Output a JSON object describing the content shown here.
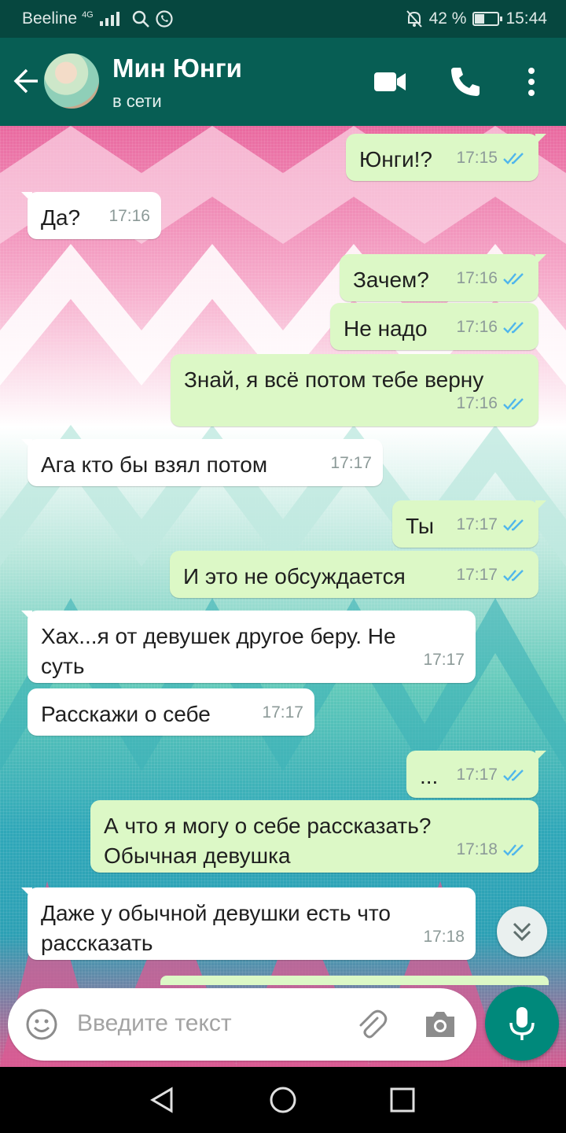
{
  "status_bar": {
    "carrier": "Beeline",
    "network": "4G",
    "battery": "42 %",
    "battery_level": 0.42,
    "time": "15:44"
  },
  "header": {
    "contact_name": "Мин Юнги",
    "contact_status": "в сети",
    "icons": [
      "back-arrow-icon",
      "video-call-icon",
      "phone-icon",
      "more-menu-icon"
    ]
  },
  "messages": [
    {
      "dir": "out",
      "text": "Юнги!?",
      "time": "17:15"
    },
    {
      "dir": "in",
      "text": "Да?",
      "time": "17:16"
    },
    {
      "dir": "out",
      "text": "Зачем?",
      "time": "17:16"
    },
    {
      "dir": "out",
      "text": "Не надо",
      "time": "17:16"
    },
    {
      "dir": "out",
      "text": "Знай, я всё потом тебе верну",
      "time": "17:16"
    },
    {
      "dir": "in",
      "text": "Ага кто бы взял потом",
      "time": "17:17"
    },
    {
      "dir": "out",
      "text": "Ты",
      "time": "17:17"
    },
    {
      "dir": "out",
      "text": "И это не обсуждается",
      "time": "17:17"
    },
    {
      "dir": "in",
      "text": "Хах...я от девушек другое беру. Не\nсуть",
      "time": "17:17"
    },
    {
      "dir": "in",
      "text": "Расскажи о себе",
      "time": "17:17"
    },
    {
      "dir": "out",
      "text": "...",
      "time": "17:17"
    },
    {
      "dir": "out",
      "text": "А что я могу о себе рассказать?\nОбычная девушка",
      "time": "17:18"
    },
    {
      "dir": "in",
      "text": "Даже у обычной девушки есть что\nрассказать",
      "time": "17:18"
    }
  ],
  "composer": {
    "placeholder": "Введите текст"
  },
  "colors": {
    "header": "#075e54",
    "status_bar": "#06473f",
    "outgoing_bubble": "#dcf8c6",
    "incoming_bubble": "#ffffff",
    "read_ticks": "#4fb6ec",
    "mic_button": "#00897b"
  }
}
